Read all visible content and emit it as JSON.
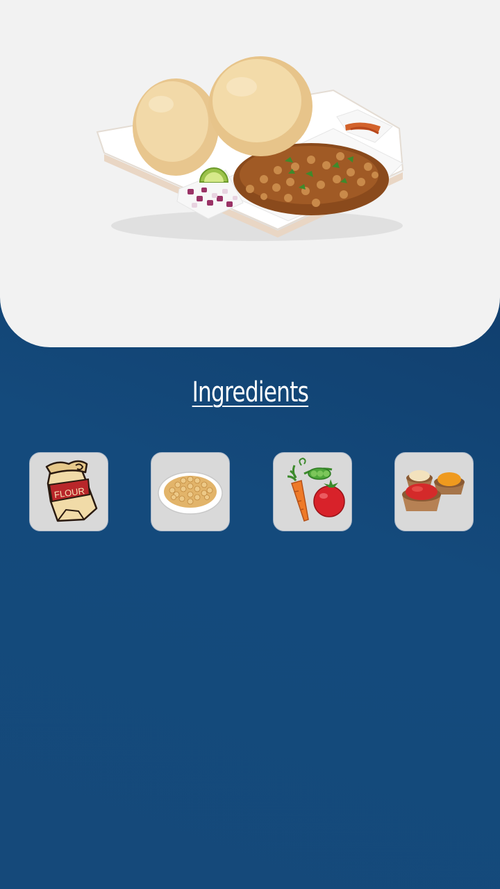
{
  "hero": {
    "image": "chole-bhature-thali-image"
  },
  "section": {
    "title": "Ingredients"
  },
  "ingredients": [
    {
      "icon": "flour-bag-icon",
      "label": "FLOUR"
    },
    {
      "icon": "chickpeas-bowl-icon"
    },
    {
      "icon": "vegetables-icon"
    },
    {
      "icon": "spices-bowls-icon"
    }
  ],
  "colors": {
    "background_top": "#0d3460",
    "background_bottom": "#15497a",
    "hero_background": "#f2f2f2",
    "tile_background": "#d9d9d9",
    "heading_text": "#ffffff"
  }
}
